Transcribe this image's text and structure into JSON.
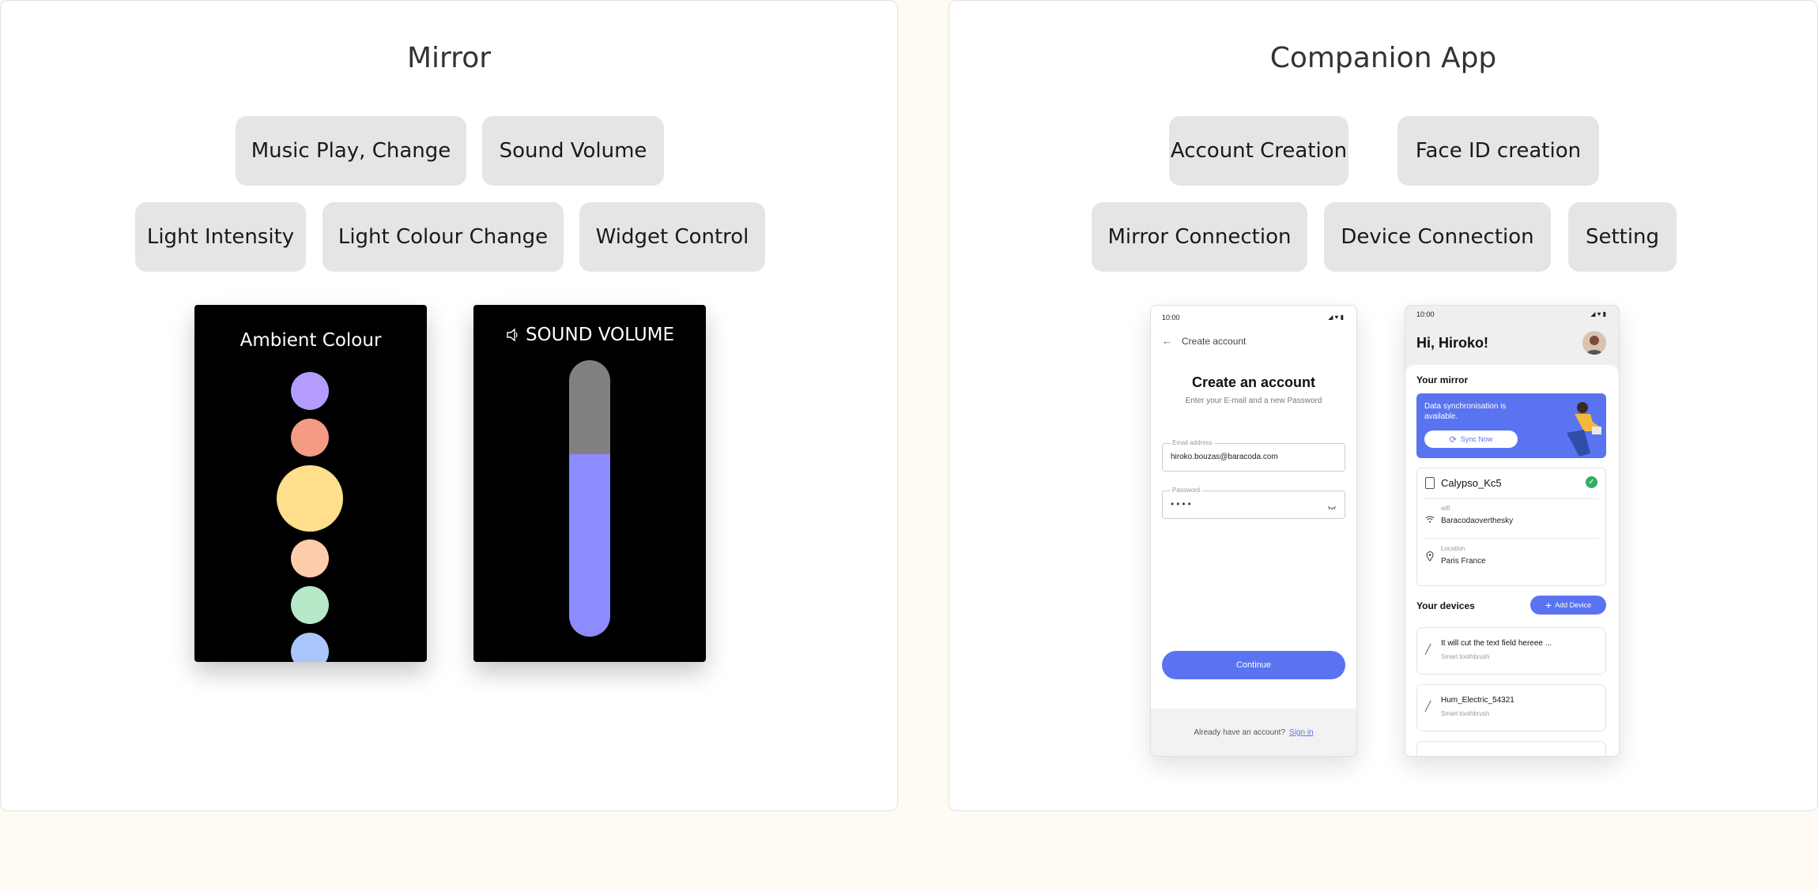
{
  "mirror": {
    "title": "Mirror",
    "features": [
      "Music Play, Change",
      "Sound Volume",
      "Light Intensity",
      "Light Colour Change",
      "Widget Control"
    ],
    "ambient": {
      "title": "Ambient Colour",
      "colors": [
        "#b39cfb",
        "#f59a85",
        "#ffdf8c",
        "#fdcdab",
        "#b7e8c8",
        "#a9c6fb"
      ]
    },
    "volume": {
      "title": "SOUND VOLUME",
      "level": 0.66,
      "track_color": "#808080",
      "fill_color": "#8c8bff"
    }
  },
  "app": {
    "title": "Companion App",
    "features": [
      "Account Creation",
      "Face ID creation",
      "Mirror Connection",
      "Device Connection",
      "Setting"
    ],
    "create_account": {
      "time": "10:00",
      "back_label": "Create account",
      "heading": "Create an account",
      "subheading": "Enter your E-mail and a new Password",
      "email_label": "Email address",
      "email_value": "hiroko.bouzas@baracoda.com",
      "password_label": "Password",
      "password_value": "••••",
      "continue_label": "Continue",
      "footer_text": "Already have an account?",
      "signin_label": "Sign in"
    },
    "home": {
      "time": "10:00",
      "greeting": "Hi, Hiroko!",
      "your_mirror": "Your mirror",
      "sync_text": "Data synchronisation is available.",
      "sync_button": "Sync Now",
      "mirror_name": "Calypso_Kc5",
      "wifi_label": "wifi",
      "wifi_value": "Baracodaoverthesky",
      "location_label": "Location",
      "location_value": "Paris France",
      "your_devices": "Your devices",
      "add_device": "Add Device",
      "devices": [
        {
          "name": "It will cut the text field hereee ...",
          "type": "Smart toothbrush"
        },
        {
          "name": "Hum_Electric_54321",
          "type": "Smart toothbrush"
        }
      ]
    },
    "accent": "#5a73f0"
  }
}
